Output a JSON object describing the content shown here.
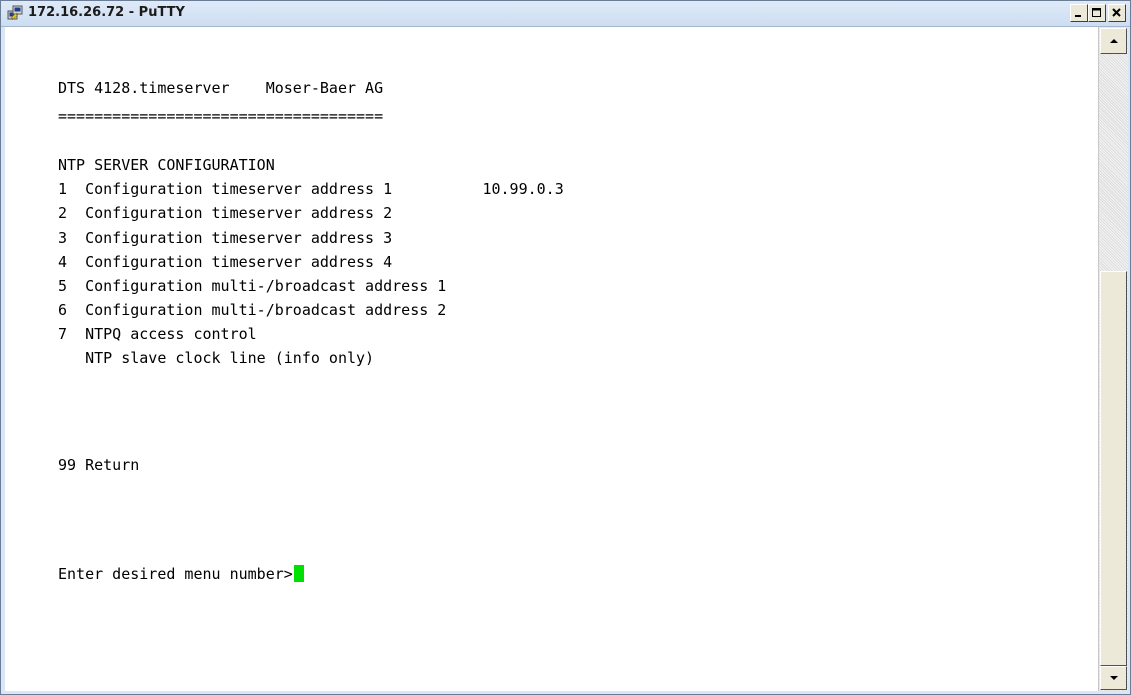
{
  "window": {
    "title": "172.16.26.72 - PuTTY",
    "icon": "putty-icon"
  },
  "terminal": {
    "header_line": "DTS 4128.timeserver    Moser-Baer AG",
    "separator": "====================================",
    "section_title": "NTP SERVER CONFIGURATION",
    "menu": [
      "1  Configuration timeserver address 1          10.99.0.3",
      "2  Configuration timeserver address 2",
      "3  Configuration timeserver address 3",
      "4  Configuration timeserver address 4",
      "5  Configuration multi-/broadcast address 1",
      "6  Configuration multi-/broadcast address 2",
      "7  NTPQ access control",
      "   NTP slave clock line (info only)"
    ],
    "return_item": "99 Return",
    "prompt": "Enter desired menu number>",
    "cursor_color": "#00e000"
  }
}
